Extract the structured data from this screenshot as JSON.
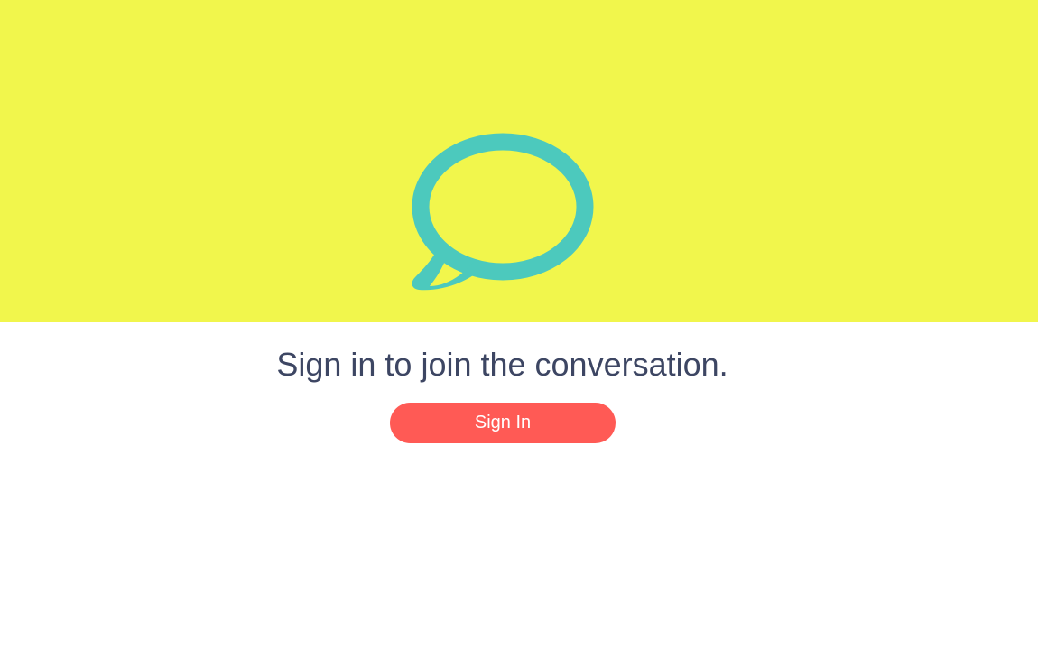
{
  "hero": {
    "icon": "speech-bubble-icon",
    "background_color": "#f1f64c",
    "icon_color": "#4cc9bd"
  },
  "main": {
    "headline": "Sign in to join the conversation.",
    "sign_in_label": "Sign In",
    "button_color": "#ff5a55",
    "text_color": "#3d4663"
  }
}
